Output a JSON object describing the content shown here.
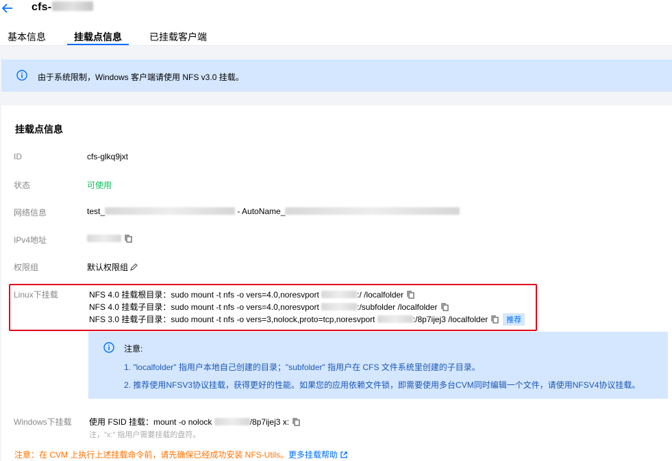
{
  "header": {
    "title": "cfs-",
    "tabs": [
      {
        "label": "基本信息"
      },
      {
        "label": "挂载点信息"
      },
      {
        "label": "已挂载客户端"
      }
    ]
  },
  "notice": {
    "text": "由于系统限制，Windows 客户端请使用 NFS v3.0 挂载。"
  },
  "section": {
    "title": "挂载点信息",
    "id_label": "ID",
    "id_value": "cfs-glkq9jxt",
    "status_label": "状态",
    "status_value": "可使用",
    "network_label": "网络信息",
    "network_prefix": "test_",
    "network_middle": " - AutoName_",
    "ipv4_label": "IPv4地址",
    "perm_label": "权限组",
    "perm_value": "默认权限组",
    "linux_label": "Linux下挂载",
    "linux_lines": [
      {
        "prefix": "NFS 4.0 挂载根目录：sudo mount -t nfs -o vers=4.0,noresvport ",
        "suffix": ":/ /localfolder"
      },
      {
        "prefix": "NFS 4.0 挂载子目录：sudo mount -t nfs -o vers=4.0,noresvport ",
        "suffix": ":/subfolder /localfolder"
      },
      {
        "prefix": "NFS 3.0 挂载子目录：sudo mount -t nfs -o vers=3,nolock,proto=tcp,noresvport ",
        "suffix": ":/8p7ijej3 /localfolder"
      }
    ],
    "recommend_badge": "推荐",
    "tip": {
      "head": "注意:",
      "line1": "1. \"localfolder\" 指用户本地自己创建的目录；\"subfolder\" 指用户在 CFS 文件系统里创建的子目录。",
      "line2": "2. 推荐使用NFSV3协议挂载，获得更好的性能。如果您的应用依赖文件锁，即需要使用多台CVM同时编辑一个文件，请使用NFSV4协议挂载。"
    },
    "windows_label": "Windows下挂载",
    "windows_prefix": "使用 FSID 挂载：mount -o nolock ",
    "windows_suffix": "/8p7ijej3 x:",
    "windows_note": "注，\"x:\" 指用户需要挂载的盘符。",
    "warn_text": "注意：在 CVM 上执行上述挂载命令前，请先确保已经成功安装 NFS-Utils。",
    "warn_link": "更多挂载帮助"
  },
  "colors": {
    "accent": "#006eff",
    "success": "#0abf5b",
    "warning": "#ff7200",
    "highlight_box": "#e1041a",
    "info_bg": "#d5e7ff"
  },
  "icons": [
    "back-arrow-icon",
    "info-icon",
    "copy-icon",
    "edit-icon",
    "external-link-icon"
  ]
}
